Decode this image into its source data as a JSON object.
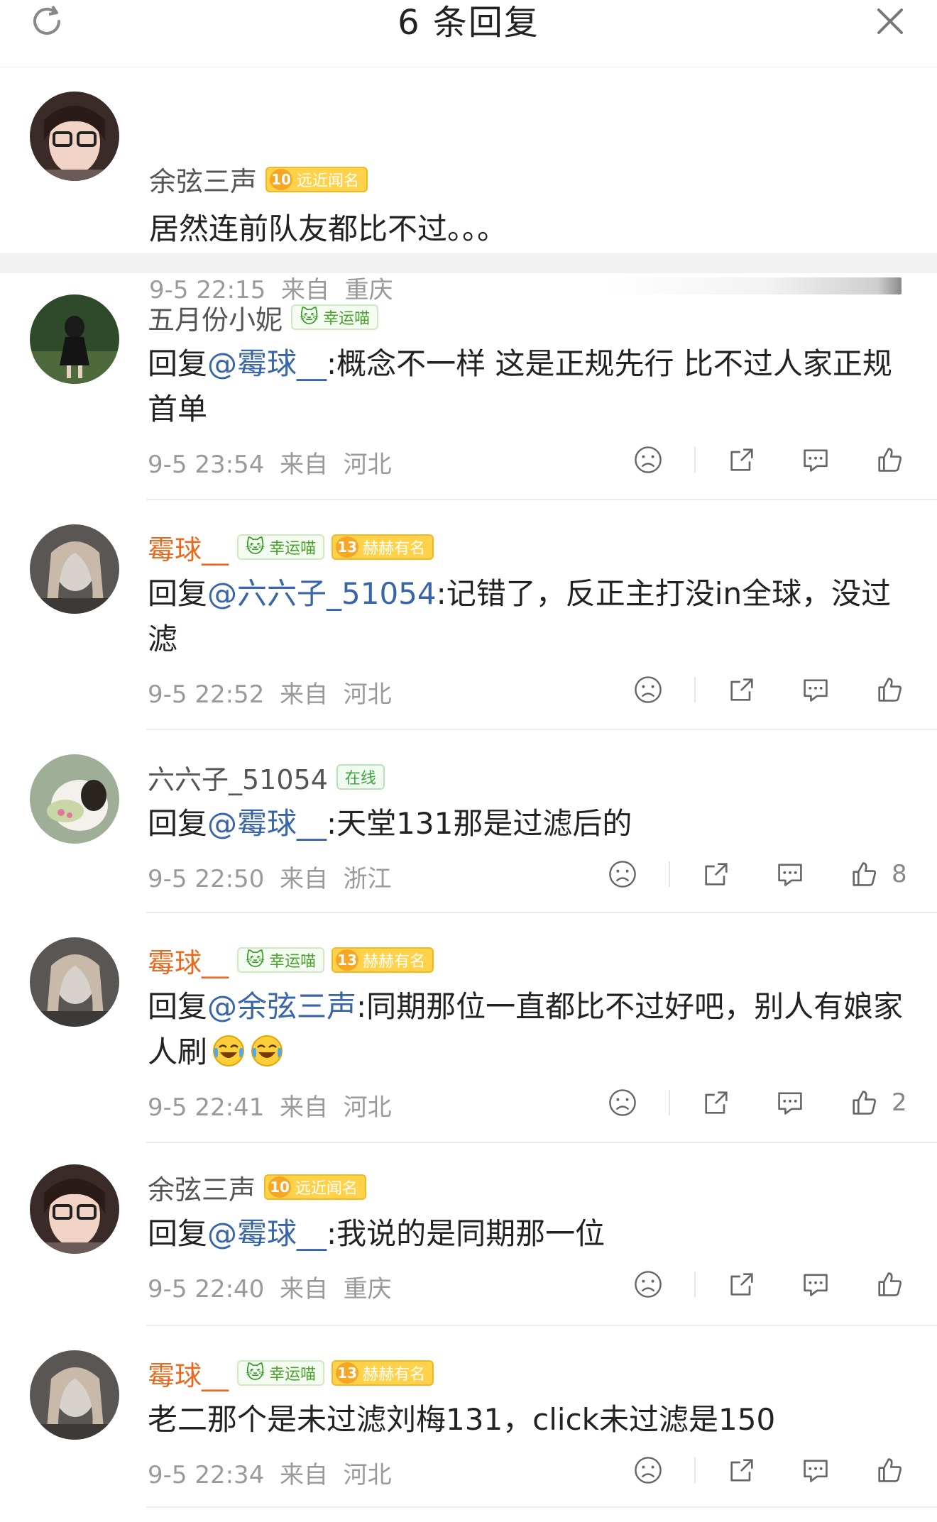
{
  "header": {
    "title": "6 条回复"
  },
  "root": {
    "username": "余弦三声",
    "level": "10",
    "badge": "远近闻名",
    "text": "居然连前队友都比不过。。。",
    "time": "9-5 22:15",
    "from": "来自",
    "location": "重庆"
  },
  "replies": [
    {
      "username": "五月份小妮",
      "badge_lucky": "幸运喵",
      "reply_prefix": "回复",
      "mention": "@霉球__",
      "text": ":概念不一样 这是正规先行  比不过人家正规首单",
      "time": "9-5 23:54",
      "from": "来自",
      "location": "河北",
      "likes": ""
    },
    {
      "username": "霉球__",
      "badge_lucky": "幸运喵",
      "level": "13",
      "badge_fame": "赫赫有名",
      "reply_prefix": "回复",
      "mention": "@六六子_51054",
      "text": ":记错了，反正主打没in全球，没过滤",
      "time": "9-5 22:52",
      "from": "来自",
      "location": "河北",
      "likes": ""
    },
    {
      "username": "六六子_51054",
      "badge_online": "在线",
      "reply_prefix": "回复",
      "mention": "@霉球__",
      "text": ":天堂131那是过滤后的",
      "time": "9-5 22:50",
      "from": "来自",
      "location": "浙江",
      "likes": "8"
    },
    {
      "username": "霉球__",
      "badge_lucky": "幸运喵",
      "level": "13",
      "badge_fame": "赫赫有名",
      "reply_prefix": "回复",
      "mention": "@余弦三声",
      "text": ":同期那位一直都比不过好吧，别人有娘家人刷",
      "time": "9-5 22:41",
      "from": "来自",
      "location": "河北",
      "likes": "2"
    },
    {
      "username": "余弦三声",
      "level": "10",
      "badge_fame": "远近闻名",
      "reply_prefix": "回复",
      "mention": "@霉球__",
      "text": ":我说的是同期那一位",
      "time": "9-5 22:40",
      "from": "来自",
      "location": "重庆",
      "likes": ""
    },
    {
      "username": "霉球__",
      "badge_lucky": "幸运喵",
      "level": "13",
      "badge_fame": "赫赫有名",
      "text": "老二那个是未过滤刘梅131，click未过滤是150",
      "time": "9-5 22:34",
      "from": "来自",
      "location": "河北",
      "likes": ""
    }
  ],
  "colors": {
    "mention": "#3966a8",
    "orange_name": "#e86a1e",
    "meta": "#9a9a9a"
  },
  "icons": [
    "refresh-icon",
    "close-icon",
    "dislike-icon",
    "share-icon",
    "comment-icon",
    "like-icon",
    "laugh-cry-emoji"
  ]
}
